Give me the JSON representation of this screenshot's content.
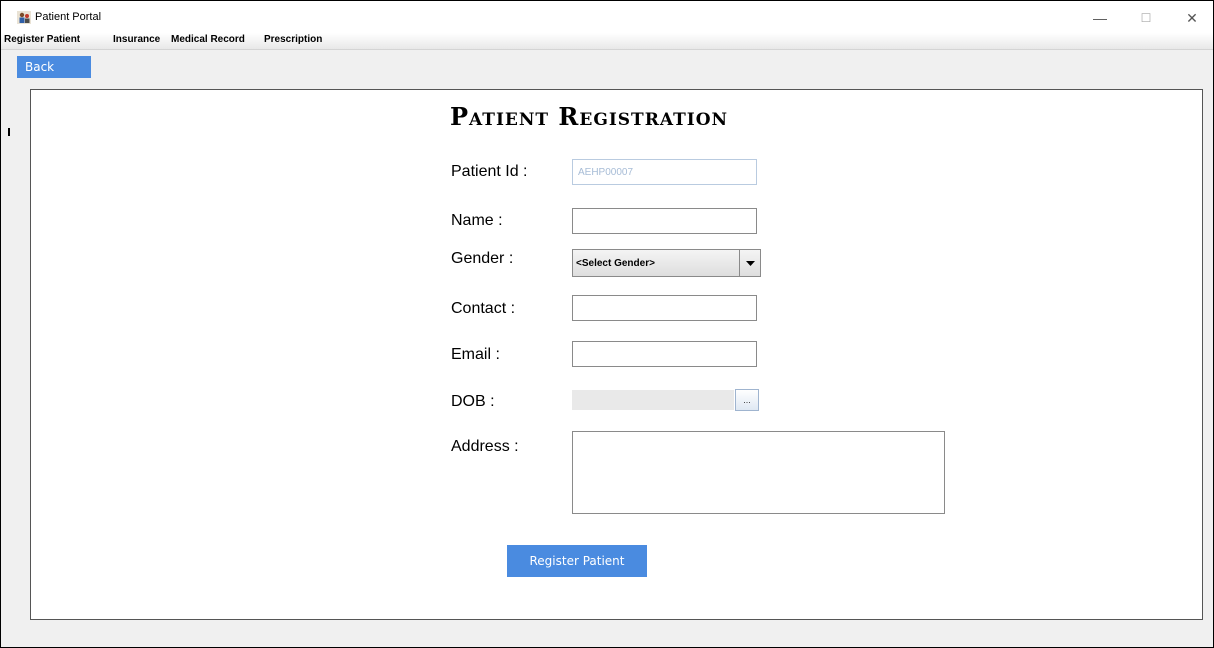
{
  "window": {
    "title": "Patient Portal",
    "controls": {
      "minimize": "—",
      "maximize": "☐",
      "close": "✕"
    }
  },
  "menu": {
    "items": [
      "Register Patient",
      "Insurance",
      "Medical Record",
      "Prescription"
    ]
  },
  "toolbar": {
    "back_label": "Back"
  },
  "form": {
    "heading": "Patient Registration",
    "patient_id_label": "Patient Id :",
    "patient_id_value": "AEHP00007",
    "name_label": "Name :",
    "name_value": "",
    "gender_label": "Gender :",
    "gender_selected": "<Select Gender>",
    "contact_label": "Contact :",
    "contact_value": "",
    "email_label": "Email :",
    "email_value": "",
    "dob_label": "DOB :",
    "dob_button": "...",
    "address_label": "Address :",
    "address_value": "",
    "submit_label": "Register Patient"
  },
  "colors": {
    "accent": "#4a8be0",
    "disabled_text": "#a7bcd6"
  }
}
